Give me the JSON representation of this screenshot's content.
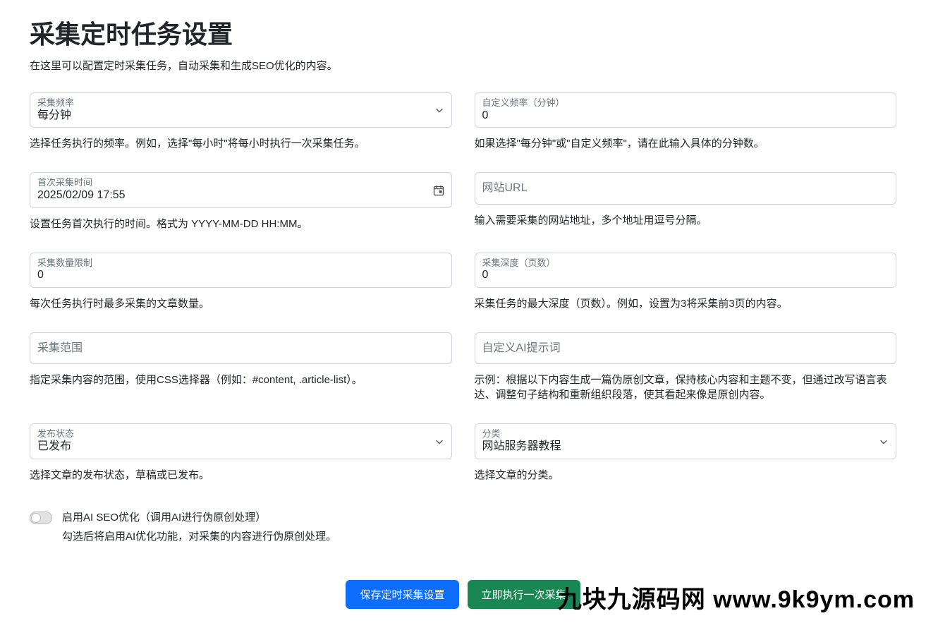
{
  "page": {
    "title": "采集定时任务设置",
    "subtitle": "在这里可以配置定时采集任务，自动采集和生成SEO优化的内容。"
  },
  "fields": {
    "frequency": {
      "label": "采集频率",
      "value": "每分钟",
      "help": "选择任务执行的频率。例如，选择\"每小时\"将每小时执行一次采集任务。"
    },
    "custom_frequency": {
      "label": "自定义频率（分钟）",
      "value": "0",
      "help": "如果选择\"每分钟\"或\"自定义频率\"，请在此输入具体的分钟数。"
    },
    "first_time": {
      "label": "首次采集时间",
      "value": "2025/02/09 17:55",
      "help": "设置任务首次执行的时间。格式为 YYYY-MM-DD HH:MM。"
    },
    "website_url": {
      "placeholder": "网站URL",
      "help": "输入需要采集的网站地址，多个地址用逗号分隔。"
    },
    "limit": {
      "label": "采集数量限制",
      "value": "0",
      "help": "每次任务执行时最多采集的文章数量。"
    },
    "depth": {
      "label": "采集深度（页数）",
      "value": "0",
      "help": "采集任务的最大深度（页数）。例如，设置为3将采集前3页的内容。"
    },
    "scope": {
      "placeholder": "采集范围",
      "help": "指定采集内容的范围，使用CSS选择器（例如：#content, .article-list）。"
    },
    "ai_prompt": {
      "placeholder": "自定义AI提示词",
      "help": "示例：根据以下内容生成一篇伪原创文章，保持核心内容和主题不变，但通过改写语言表达、调整句子结构和重新组织段落，使其看起来像是原创内容。"
    },
    "publish_status": {
      "label": "发布状态",
      "value": "已发布",
      "help": "选择文章的发布状态，草稿或已发布。"
    },
    "category": {
      "label": "分类",
      "value": "网站服务器教程",
      "help": "选择文章的分类。"
    },
    "ai_seo": {
      "label": "启用AI SEO优化（调用AI进行伪原创处理）",
      "desc": "勾选后将启用AI优化功能，对采集的内容进行伪原创处理。"
    }
  },
  "buttons": {
    "save": "保存定时采集设置",
    "run_now": "立即执行一次采集"
  },
  "watermark": "九块九源码网 www.9k9ym.com"
}
